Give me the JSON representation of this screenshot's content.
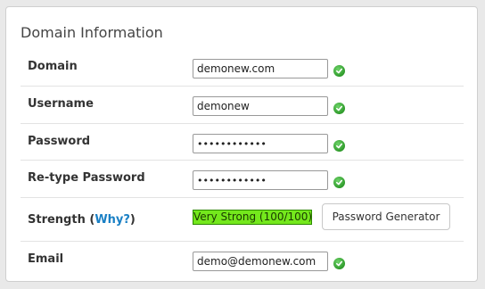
{
  "panel": {
    "title": "Domain Information"
  },
  "fields": {
    "domain": {
      "label": "Domain",
      "value": "demonew.com"
    },
    "username": {
      "label": "Username",
      "value": "demonew"
    },
    "password": {
      "label": "Password",
      "value": "••••••••••••"
    },
    "retype_password": {
      "label": "Re-type Password",
      "value": "••••••••••••"
    },
    "strength": {
      "label": "Strength (",
      "why_link": "Why?",
      "label_close": ")",
      "meter_text": "Very Strong (100/100)",
      "meter_value": 100,
      "meter_color": "#74e81c"
    },
    "email": {
      "label": "Email",
      "value": "demo@demonew.com"
    }
  },
  "buttons": {
    "password_generator": "Password Generator"
  },
  "colors": {
    "accent_link": "#1a80c5",
    "valid_green": "#2e9a2a"
  },
  "icons": {
    "valid": "check-circle-icon"
  }
}
